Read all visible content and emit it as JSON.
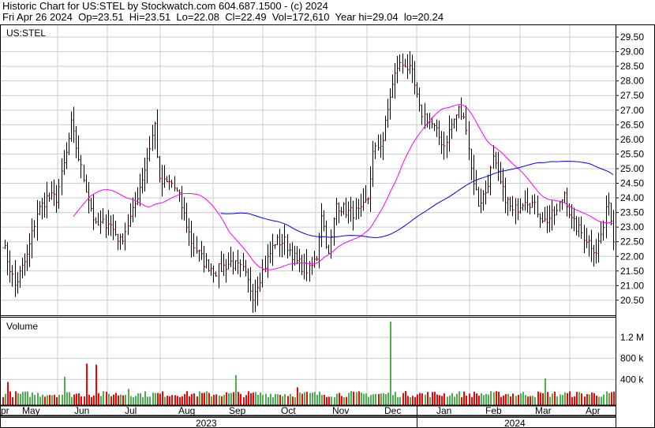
{
  "header": {
    "title": "Historic Chart for US:STEL by Stockwatch.com 604.687.1500 - (c) 2024",
    "quote": "Fri Apr 26 2024  Op=23.51  Hi=23.51  Lo=22.08  Cl=22.49  Vol=172,610  Year hi=29.04  lo=20.24"
  },
  "chart_data": {
    "type": "ohlc",
    "symbol": "US:STEL",
    "volume_label": "Volume",
    "price_ticks": [
      "29.50",
      "29.00",
      "28.50",
      "28.00",
      "27.50",
      "27.00",
      "26.50",
      "26.00",
      "25.50",
      "25.00",
      "24.50",
      "24.00",
      "23.50",
      "23.00",
      "22.50",
      "22.00",
      "21.50",
      "21.00",
      "20.50"
    ],
    "price_range": [
      20.0,
      29.8
    ],
    "volume_ticks": [
      {
        "v": 1200000,
        "label": "1.2 M"
      },
      {
        "v": 800000,
        "label": "800 k"
      },
      {
        "v": 400000,
        "label": "400 k"
      }
    ],
    "months": [
      "pr",
      "May",
      "Jun",
      "Jul",
      "Aug",
      "Sep",
      "Oct",
      "Nov",
      "Dec",
      "Jan",
      "Feb",
      "Mar",
      "Apr"
    ],
    "years": [
      "2023",
      "2024"
    ],
    "trading_days": 250,
    "close_keypoints": [
      [
        0,
        22.5
      ],
      [
        5,
        21.0
      ],
      [
        10,
        22.0
      ],
      [
        14,
        23.5
      ],
      [
        18,
        24.0
      ],
      [
        22,
        24.0
      ],
      [
        26,
        25.5
      ],
      [
        28,
        26.5
      ],
      [
        32,
        25.0
      ],
      [
        35,
        24.0
      ],
      [
        38,
        23.0
      ],
      [
        43,
        23.2
      ],
      [
        48,
        22.5
      ],
      [
        53,
        23.5
      ],
      [
        58,
        25.0
      ],
      [
        62,
        26.5
      ],
      [
        64,
        24.5
      ],
      [
        69,
        24.5
      ],
      [
        72,
        24.0
      ],
      [
        77,
        22.5
      ],
      [
        82,
        21.8
      ],
      [
        87,
        21.5
      ],
      [
        93,
        21.8
      ],
      [
        98,
        21.5
      ],
      [
        102,
        20.7
      ],
      [
        106,
        21.5
      ],
      [
        111,
        22.5
      ],
      [
        115,
        22.5
      ],
      [
        120,
        21.8
      ],
      [
        125,
        21.5
      ],
      [
        128,
        22.0
      ],
      [
        130,
        23.5
      ],
      [
        133,
        22.0
      ],
      [
        136,
        23.8
      ],
      [
        141,
        23.5
      ],
      [
        146,
        23.5
      ],
      [
        149,
        24.0
      ],
      [
        151,
        25.5
      ],
      [
        155,
        26.0
      ],
      [
        158,
        27.5
      ],
      [
        161,
        28.5
      ],
      [
        164,
        28.6
      ],
      [
        167,
        28.2
      ],
      [
        170,
        27.0
      ],
      [
        175,
        26.5
      ],
      [
        180,
        25.8
      ],
      [
        183,
        26.5
      ],
      [
        186,
        27.0
      ],
      [
        189,
        26.5
      ],
      [
        191,
        25.0
      ],
      [
        194,
        23.8
      ],
      [
        197,
        24.2
      ],
      [
        200,
        25.3
      ],
      [
        204,
        24.2
      ],
      [
        208,
        23.5
      ],
      [
        213,
        24.0
      ],
      [
        216,
        23.8
      ],
      [
        221,
        23.2
      ],
      [
        226,
        23.5
      ],
      [
        229,
        24.2
      ],
      [
        232,
        23.2
      ],
      [
        237,
        22.7
      ],
      [
        242,
        22.2
      ],
      [
        245,
        23.0
      ],
      [
        247,
        24.0
      ],
      [
        249,
        22.49
      ]
    ],
    "volume_spikes": [
      [
        2,
        350000
      ],
      [
        25,
        450000
      ],
      [
        34,
        700000
      ],
      [
        38,
        680000
      ],
      [
        95,
        480000
      ],
      [
        158,
        1500000
      ],
      [
        221,
        420000
      ],
      [
        51,
        220000
      ],
      [
        120,
        250000
      ]
    ],
    "moving_averages": [
      {
        "name": "short",
        "color": "#ff00ff",
        "period": 30
      },
      {
        "name": "long",
        "color": "#0000ff",
        "period": 90
      }
    ],
    "up_color": "#4caf50",
    "down_color": "#ff0000"
  }
}
